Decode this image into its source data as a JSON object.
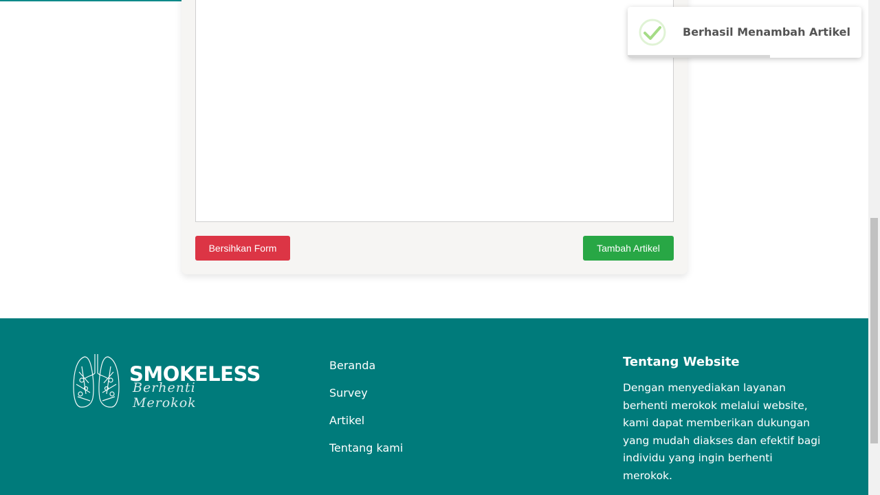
{
  "form": {
    "clear_label": "Bersihkan Form",
    "submit_label": "Tambah Artikel"
  },
  "footer": {
    "brand": "SMOKELESS",
    "tagline": "Berhenti Merokok",
    "nav": [
      "Beranda",
      "Survey",
      "Artikel",
      "Tentang kami"
    ],
    "about_title": "Tentang Website",
    "about_text": "Dengan menyediakan layanan berhenti merokok melalui website, kami dapat memberikan dukungan yang mudah diakses dan efektif bagi individu yang ingin berhenti merokok."
  },
  "toast": {
    "message": "Berhasil Menambah Artikel",
    "icon": "success-check-icon",
    "progress_remaining": 0.61
  },
  "colors": {
    "footer_bg": "#007b7b",
    "danger": "#dc3545",
    "success": "#28a745",
    "toast_check": "#a5dc86"
  }
}
